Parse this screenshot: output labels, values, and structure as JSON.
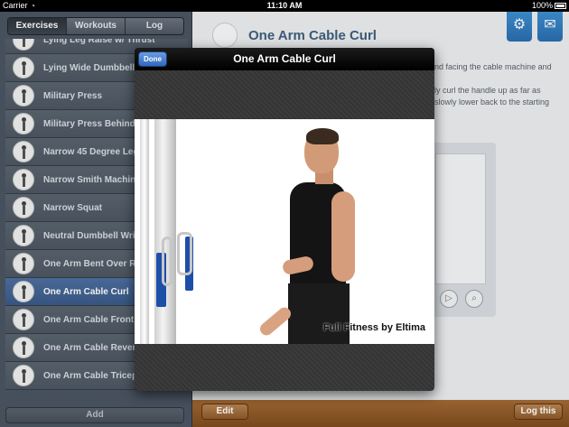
{
  "status_bar": {
    "carrier": "Carrier",
    "time": "11:10 AM",
    "battery": "100%"
  },
  "sidebar": {
    "tabs": [
      {
        "label": "Exercises",
        "active": true
      },
      {
        "label": "Workouts",
        "active": false
      },
      {
        "label": "Log",
        "active": false
      }
    ],
    "items": [
      {
        "label": "Lying Leg Raise w/ Thrust"
      },
      {
        "label": "Lying Wide Dumbbell"
      },
      {
        "label": "Military Press"
      },
      {
        "label": "Military Press Behind"
      },
      {
        "label": "Narrow 45 Degree Leg"
      },
      {
        "label": "Narrow Smith Machin"
      },
      {
        "label": "Narrow Squat"
      },
      {
        "label": "Neutral Dumbbell Wri"
      },
      {
        "label": "One Arm Bent Over R"
      },
      {
        "label": "One Arm Cable Curl",
        "selected": true
      },
      {
        "label": "One Arm Cable Front"
      },
      {
        "label": "One Arm Cable Rever"
      },
      {
        "label": "One Arm Cable Tricep"
      }
    ],
    "add_label": "Add"
  },
  "detail": {
    "title": "One Arm Cable Curl",
    "description_lines": [
      "nd facing the cable machine and",
      "",
      "ly curl the handle up as far as",
      "slowly lower back to the starting"
    ],
    "settings_icon": "gear-icon",
    "mail_icon": "mail-icon"
  },
  "toolbar": {
    "edit_label": "Edit",
    "log_label": "Log this"
  },
  "modal": {
    "title": "One Arm Cable Curl",
    "done_label": "Done",
    "watermark": "Full Fitness by Eltima"
  },
  "colors": {
    "accent_blue": "#2f69c0",
    "toolbar_brown": "#8f5a2a",
    "sidebar_bg": "#4b5663",
    "title_blue": "#3f5f7e"
  }
}
